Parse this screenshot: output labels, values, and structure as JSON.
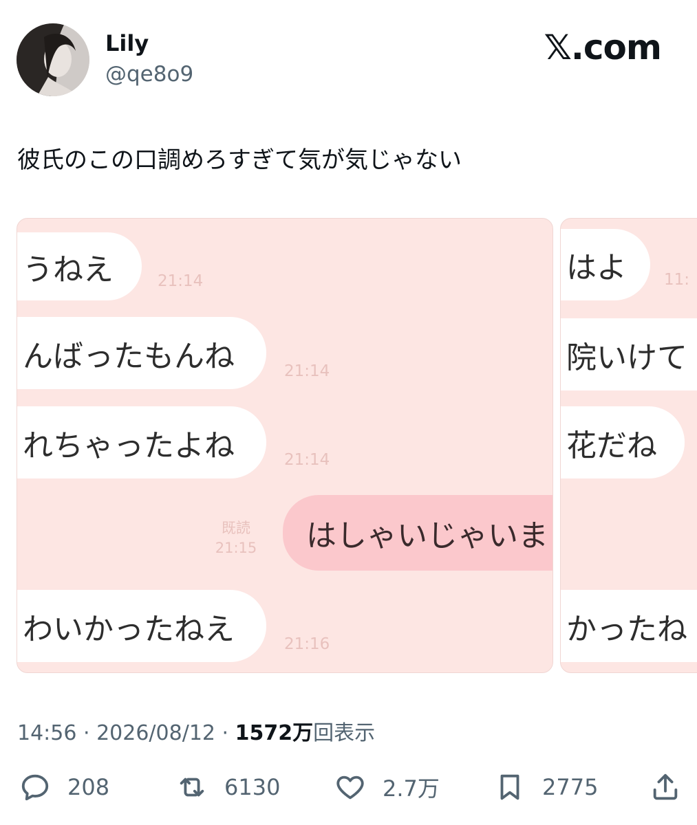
{
  "author": {
    "name": "Lily",
    "handle": "@qe8o9"
  },
  "brand": "𝕏.com",
  "tweet_text": "彼氏のこの口調めろすぎて気が気じゃない",
  "image1": {
    "messages": [
      {
        "text": "うねえ",
        "time": "21:14"
      },
      {
        "text": "んばったもんね",
        "time": "21:14"
      },
      {
        "text": "れちゃったよね",
        "time": "21:14"
      },
      {
        "text": "はしゃいじゃいま",
        "read": "既読",
        "time": "21:15"
      },
      {
        "text": "わいかったねえ",
        "time": "21:16"
      }
    ]
  },
  "image2": {
    "messages": [
      {
        "text": "はよ",
        "time": "11:"
      },
      {
        "text": "院いけて"
      },
      {
        "text": "花だね"
      },
      {
        "text": "かったね"
      }
    ]
  },
  "meta": {
    "time": "14:56",
    "sep": " · ",
    "date": "2026/08/12",
    "views_num": "1572万",
    "views_label": "回表示"
  },
  "actions": {
    "replies": "208",
    "reposts": "6130",
    "likes": "2.7万",
    "bookmarks": "2775"
  },
  "colors": {
    "text": "#0f1419",
    "muted": "#536471",
    "chat_bg": "#fde6e3",
    "sent_bubble": "#fbc8cc"
  }
}
